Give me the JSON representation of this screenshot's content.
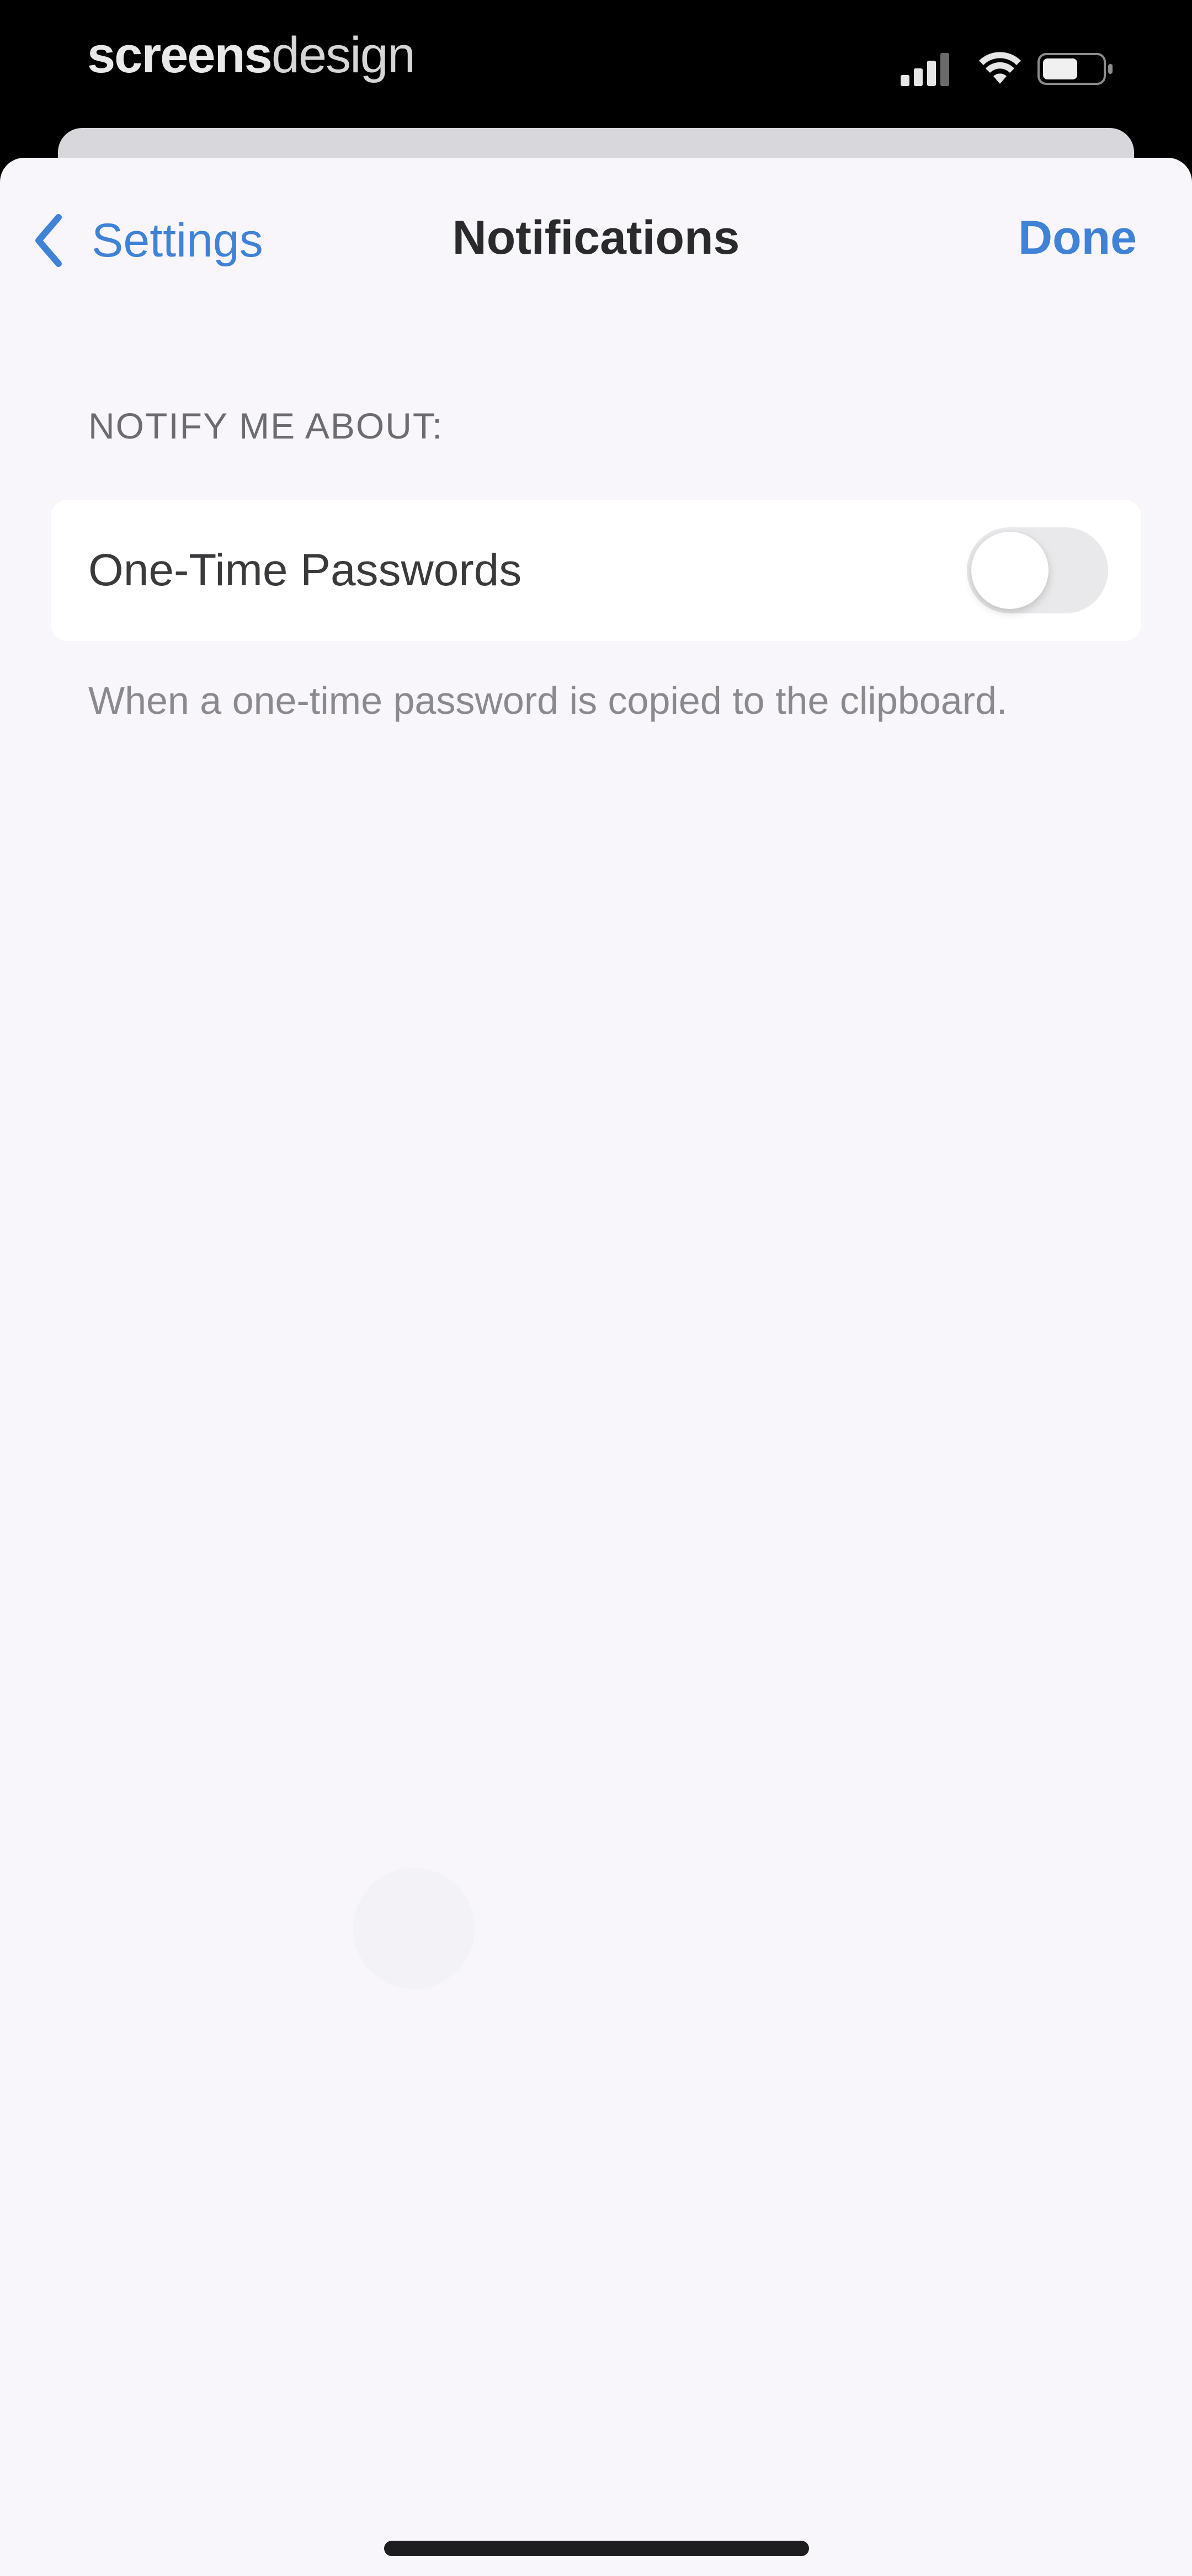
{
  "status_bar": {
    "brand_strong": "screens",
    "brand_light": "design",
    "icons": [
      "cellular-signal-icon",
      "wifi-icon",
      "battery-icon"
    ]
  },
  "nav": {
    "back_label": "Settings",
    "title": "Notifications",
    "done_label": "Done"
  },
  "section": {
    "header": "NOTIFY ME ABOUT:",
    "rows": [
      {
        "label": "One-Time Passwords",
        "toggle_on": false
      }
    ],
    "footer": "When a one-time password is copied to the clipboard."
  },
  "colors": {
    "accent": "#3f82d6",
    "background": "#f8f6fa",
    "cell": "#ffffff",
    "status_bar": "#000000"
  }
}
